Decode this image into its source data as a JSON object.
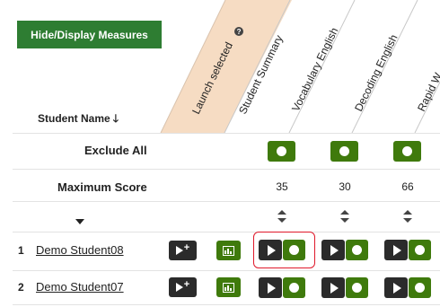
{
  "toolbar": {
    "measures_label": "Hide/Display Measures"
  },
  "columns": {
    "launch_selected": "Launch selected",
    "student_summary": "Student Summary",
    "vocabulary": "Vocabulary English",
    "decoding": "Decoding English",
    "rapid": "Rapid W"
  },
  "table": {
    "student_name_header": "Student Name",
    "exclude_all_label": "Exclude All",
    "max_score_label": "Maximum Score",
    "max_scores": [
      "35",
      "30",
      "66"
    ],
    "rows": [
      {
        "num": "1",
        "name": "Demo Student08"
      },
      {
        "num": "2",
        "name": "Demo Student07"
      }
    ]
  },
  "colors": {
    "green": "#3f7a0c",
    "header_green": "#2e7d32",
    "peach": "#f6dcc3",
    "dark": "#2b2b2b",
    "highlight": "#e0192b"
  },
  "icons": [
    "info-icon",
    "sort-down-arrow-icon",
    "sort-icon",
    "caret-down-icon",
    "play-icon",
    "toggle-dot-icon",
    "launch-plus-icon",
    "chart-icon"
  ]
}
